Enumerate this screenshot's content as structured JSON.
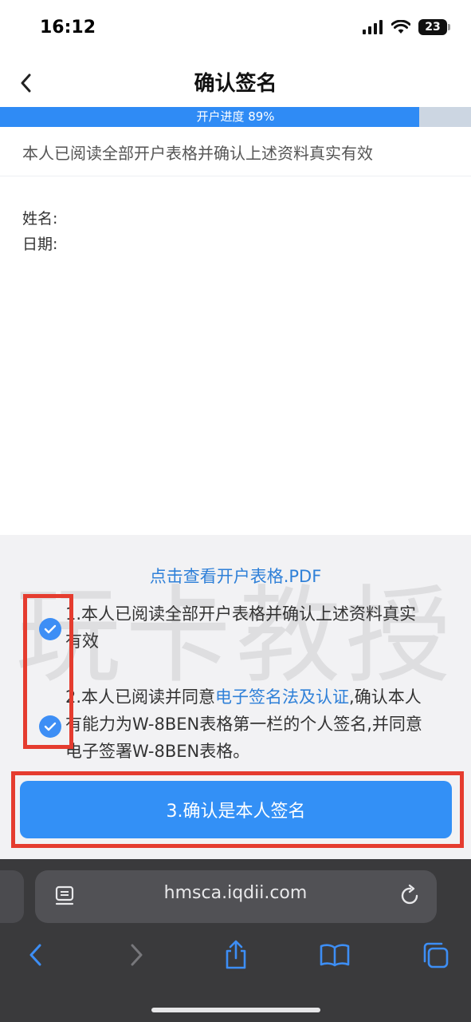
{
  "status_bar": {
    "time": "16:12",
    "battery": "23"
  },
  "header": {
    "title": "确认签名"
  },
  "progress": {
    "label": "开户进度 89%",
    "fraction": 0.89
  },
  "confirm_statement": "本人已阅读全部开户表格并确认上述资料真实有效",
  "info": {
    "name_label": "姓名:",
    "date_label": "日期:"
  },
  "panel": {
    "watermark": "玩卡教授",
    "pdf_link": "点击查看开户表格.PDF",
    "agreement_1": "1.本人已阅读全部开户表格并确认上述资料真实有效",
    "agreement_2_prefix": "2.本人已阅读并同意",
    "agreement_2_link": "电子签名法及认证",
    "agreement_2_suffix": ",确认本人有能力为W-8BEN表格第一栏的个人签名,并同意电子签署W-8BEN表格。",
    "confirm_button": "3.确认是本人签名"
  },
  "browser": {
    "url": "hmsca.iqdii.com"
  },
  "colors": {
    "accent": "#3390f6",
    "highlight": "#e53c2f",
    "panel_bg": "#f2f2f4"
  },
  "icons": [
    "back-chevron-icon",
    "signal-icon",
    "wifi-icon",
    "battery-icon",
    "check-icon",
    "page-icon",
    "reload-icon",
    "browser-back-icon",
    "browser-forward-icon",
    "share-icon",
    "bookmarks-icon",
    "tabs-icon"
  ]
}
